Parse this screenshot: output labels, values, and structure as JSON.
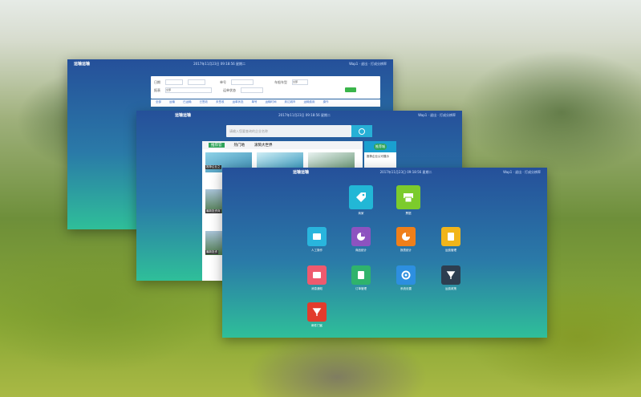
{
  "colors": {
    "accent": "#27b0d6",
    "green": "#3ab54a",
    "header": "#25509a",
    "teal": "#2fbf99"
  },
  "win1": {
    "title": "运输运输",
    "datetime": "2017年11月23日 09:18:56 星期二",
    "user": "Wap1 · 退出 · 打成分辨率",
    "row1": [
      "日期",
      "2017-10-01",
      "2017-10-31",
      "单号",
      "",
      "车船车型",
      "全部"
    ],
    "row2": [
      "报表",
      "全部",
      "",
      "运单状态",
      ""
    ],
    "button": "查询",
    "tabs": [
      "全部",
      "运输",
      "已运输",
      "已签收",
      "未签收",
      "运单状态",
      "单号",
      "运输时间",
      "到达城市",
      "运输费用",
      "操作"
    ]
  },
  "win2": {
    "title": "运输运输",
    "datetime": "2017年11月23日 09:18:56 星期二",
    "user": "Wap1 · 退出 · 打成分辨率",
    "search_placeholder": "请输入您要查询的企业名称",
    "tabs": [
      "推荐官",
      "热门地",
      "滚筒大世界"
    ],
    "captions": [
      "推荐企业之",
      "最新投资商",
      "最新投资"
    ],
    "side_badge": "推荐城",
    "side_text": "推荐企业认可展示"
  },
  "win3": {
    "title": "运输运输",
    "datetime": "2017年11月23日 09:18:56 星期二",
    "user": "Wap1 · 退出 · 打成分辨率",
    "apps": [
      {
        "label": "商家",
        "icon": "tag-icon",
        "color": "#22b7d6"
      },
      {
        "label": "票据",
        "icon": "printer-icon",
        "color": "#7ccb2c"
      },
      {
        "label": "人工操作",
        "icon": "card-icon",
        "color": "#29b5dd"
      },
      {
        "label": "商品统计",
        "icon": "pie-icon",
        "color": "#8d53c0"
      },
      {
        "label": "报表统计",
        "icon": "pie-icon",
        "color": "#ef7f1a"
      },
      {
        "label": "运费管理",
        "icon": "document-icon",
        "color": "#f1b51b"
      },
      {
        "label": "消息通知",
        "icon": "message-icon",
        "color": "#ee5a6e"
      },
      {
        "label": "订单管理",
        "icon": "list-icon",
        "color": "#2fb36c"
      },
      {
        "label": "系统设置",
        "icon": "gear-icon",
        "color": "#2d8fe0"
      },
      {
        "label": "运费政策",
        "icon": "shield-icon",
        "color": "#2d3e50"
      },
      {
        "label": "邮件门客",
        "icon": "shield-icon",
        "color": "#e23b2c"
      }
    ]
  }
}
